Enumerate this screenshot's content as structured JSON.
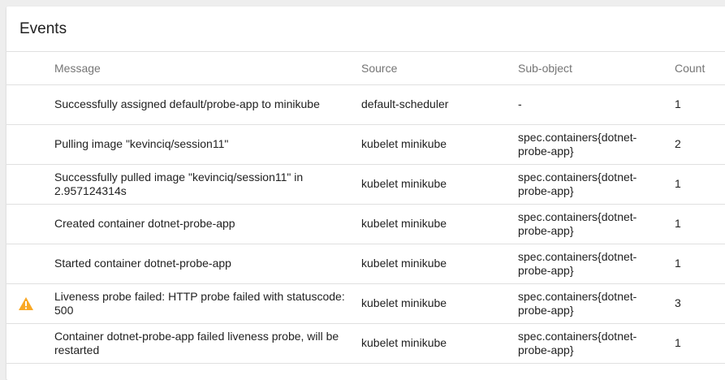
{
  "card": {
    "title": "Events"
  },
  "table": {
    "headers": {
      "message": "Message",
      "source": "Source",
      "subobject": "Sub-object",
      "count": "Count"
    },
    "rows": [
      {
        "icon": "",
        "message": "Successfully assigned default/probe-app to minikube",
        "source": "default-scheduler",
        "subobject": "-",
        "count": "1"
      },
      {
        "icon": "",
        "message": "Pulling image \"kevinciq/session11\"",
        "source": "kubelet minikube",
        "subobject": "spec.containers{dotnet-probe-app}",
        "count": "2"
      },
      {
        "icon": "",
        "message": "Successfully pulled image \"kevinciq/session11\" in 2.957124314s",
        "source": "kubelet minikube",
        "subobject": "spec.containers{dotnet-probe-app}",
        "count": "1"
      },
      {
        "icon": "",
        "message": "Created container dotnet-probe-app",
        "source": "kubelet minikube",
        "subobject": "spec.containers{dotnet-probe-app}",
        "count": "1"
      },
      {
        "icon": "",
        "message": "Started container dotnet-probe-app",
        "source": "kubelet minikube",
        "subobject": "spec.containers{dotnet-probe-app}",
        "count": "1"
      },
      {
        "icon": "warning-icon",
        "message": "Liveness probe failed: HTTP probe failed with statuscode: 500",
        "source": "kubelet minikube",
        "subobject": "spec.containers{dotnet-probe-app}",
        "count": "3"
      },
      {
        "icon": "",
        "message": "Container dotnet-probe-app failed liveness probe, will be restarted",
        "source": "kubelet minikube",
        "subobject": "spec.containers{dotnet-probe-app}",
        "count": "1"
      }
    ]
  },
  "colors": {
    "warning": "#f9a825",
    "text": "#212121",
    "header_text": "#757575",
    "divider": "#e0e0e0"
  }
}
